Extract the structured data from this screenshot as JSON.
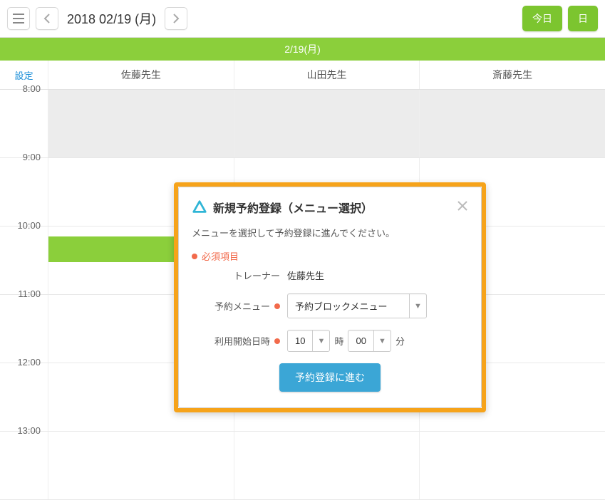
{
  "toolbar": {
    "date_label": "2018 02/19 (月)",
    "today_btn": "今日",
    "day_btn": "日"
  },
  "date_strip": "2/19(月)",
  "settings_label": "設定",
  "trainers": [
    "佐藤先生",
    "山田先生",
    "斎藤先生"
  ],
  "hours": [
    "8:00",
    "9:00",
    "10:00",
    "11:00",
    "12:00",
    "13:00"
  ],
  "modal": {
    "title": "新規予約登録（メニュー選択）",
    "desc": "メニューを選択して予約登録に進んでください。",
    "required_legend": "必須項目",
    "trainer_label": "トレーナー",
    "trainer_value": "佐藤先生",
    "menu_label": "予約メニュー",
    "menu_value": "予約ブロックメニュー",
    "datetime_label": "利用開始日時",
    "hour_value": "10",
    "hour_unit": "時",
    "minute_value": "00",
    "minute_unit": "分",
    "submit": "予約登録に進む"
  }
}
